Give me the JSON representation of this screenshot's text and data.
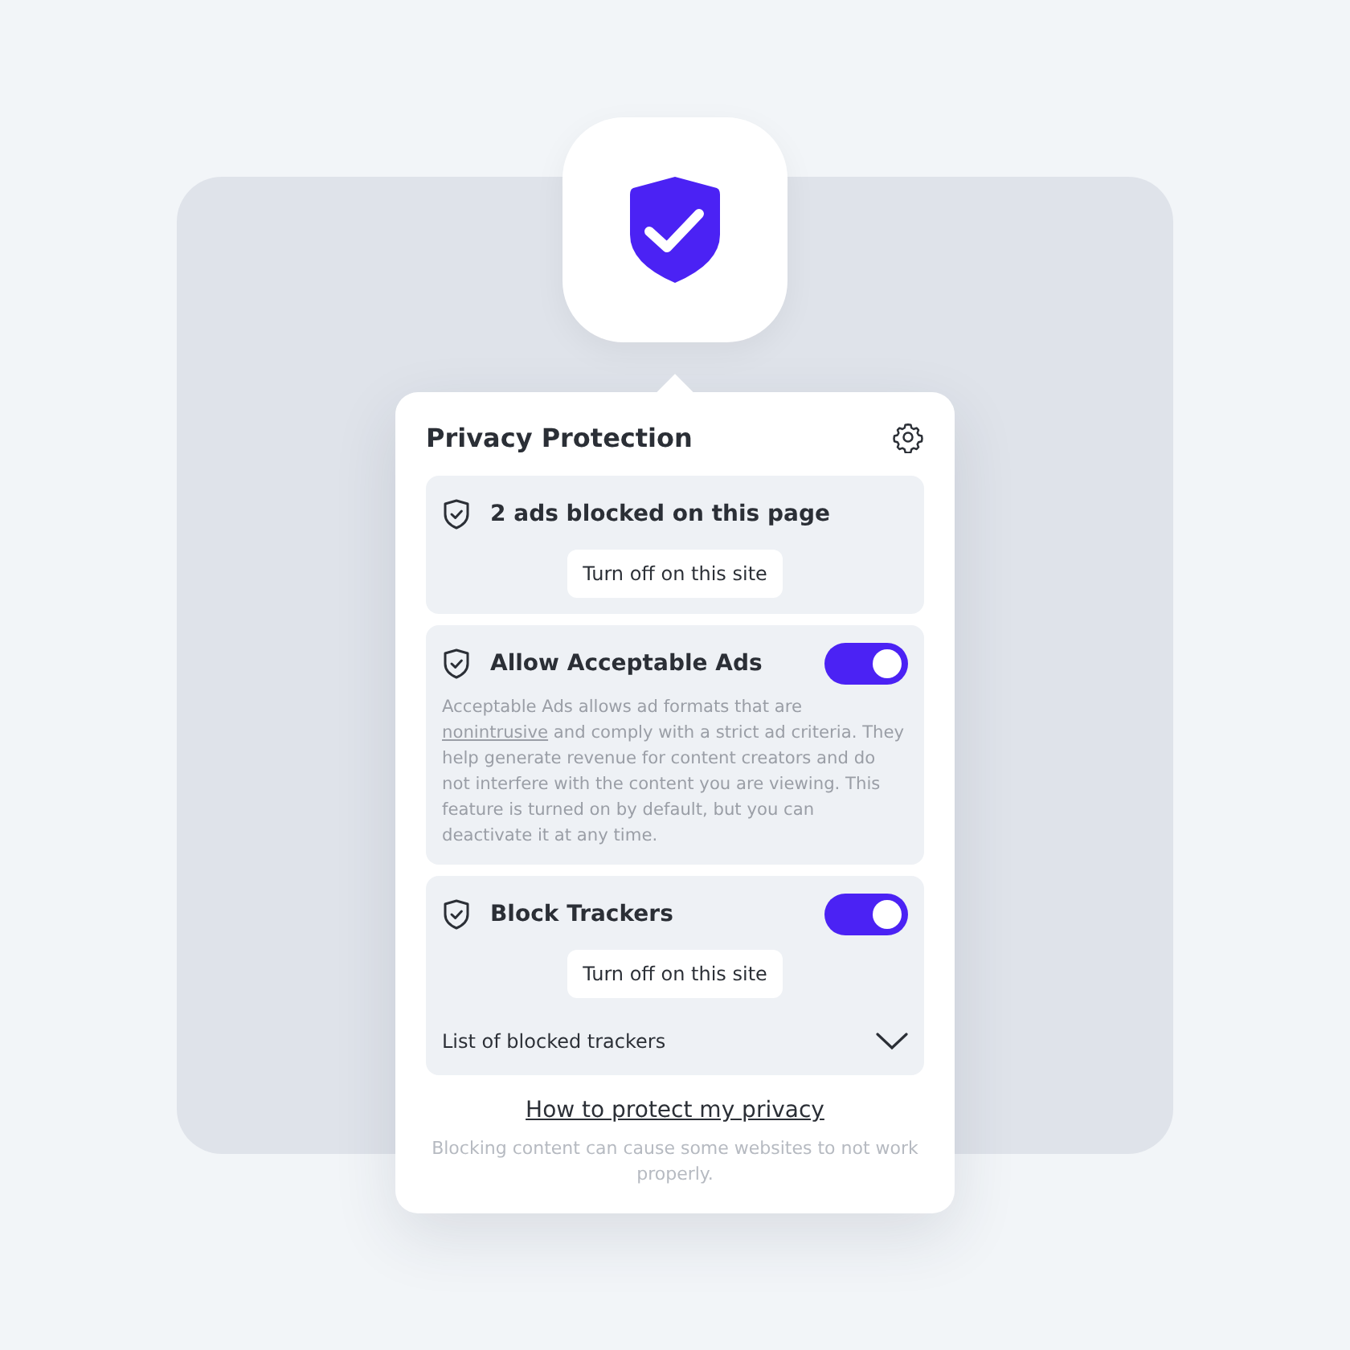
{
  "popup": {
    "title": "Privacy Protection",
    "sections": [
      {
        "title": "2 ads blocked on this page",
        "button": "Turn off on this site"
      },
      {
        "title": "Allow Acceptable Ads",
        "on": true,
        "description": {
          "before": "Acceptable Ads allows ad formats that are",
          "link": "nonintrusive",
          "after": "and comply with a strict ad criteria. They help generate revenue for content creators and do not interfere with the content you are viewing. This feature is turned on by default, but you can deactivate it at any time."
        }
      },
      {
        "title": "Block Trackers",
        "on": true,
        "button": "Turn off on this site",
        "expander": {
          "label": "List of blocked trackers",
          "expanded": false
        }
      }
    ],
    "link": "How to protect my privacy",
    "note": "Blocking content can cause some websites to not work properly."
  }
}
